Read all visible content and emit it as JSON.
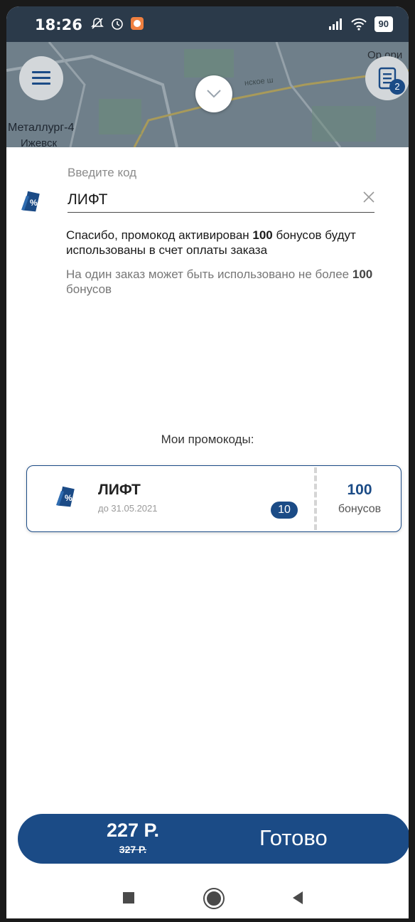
{
  "status_bar": {
    "time": "18:26",
    "battery": "90",
    "icons": [
      "mute-icon",
      "alarm-icon",
      "app-notification-icon",
      "signal-icon",
      "wifi-icon",
      "battery-icon"
    ]
  },
  "map": {
    "label_1": "Металлург-4",
    "label_2": "Ижевск",
    "street": "нское ш",
    "label_3": "Ор ори",
    "orders_badge": "2"
  },
  "promo_input": {
    "label": "Введите код",
    "value": "ЛИФТ"
  },
  "messages": {
    "success_prefix": "Спасибо, промокод активирован ",
    "success_bonus": "100",
    "success_suffix": " бонусов будут использованы в счет оплаты заказа",
    "limit_prefix": "На один заказ может быть использовано не более ",
    "limit_bonus": "100",
    "limit_suffix": " бонусов"
  },
  "my_promos": {
    "title": "Мои промокоды:",
    "items": [
      {
        "name": "ЛИФТ",
        "date": "до 31.05.2021",
        "count": "10",
        "amount": "100",
        "unit": "бонусов"
      }
    ]
  },
  "footer": {
    "price": "227 Р.",
    "old_price": "327 Р.",
    "done_label": "Готово"
  },
  "colors": {
    "accent": "#1b4b86",
    "status_bar": "#2b3a4a"
  }
}
